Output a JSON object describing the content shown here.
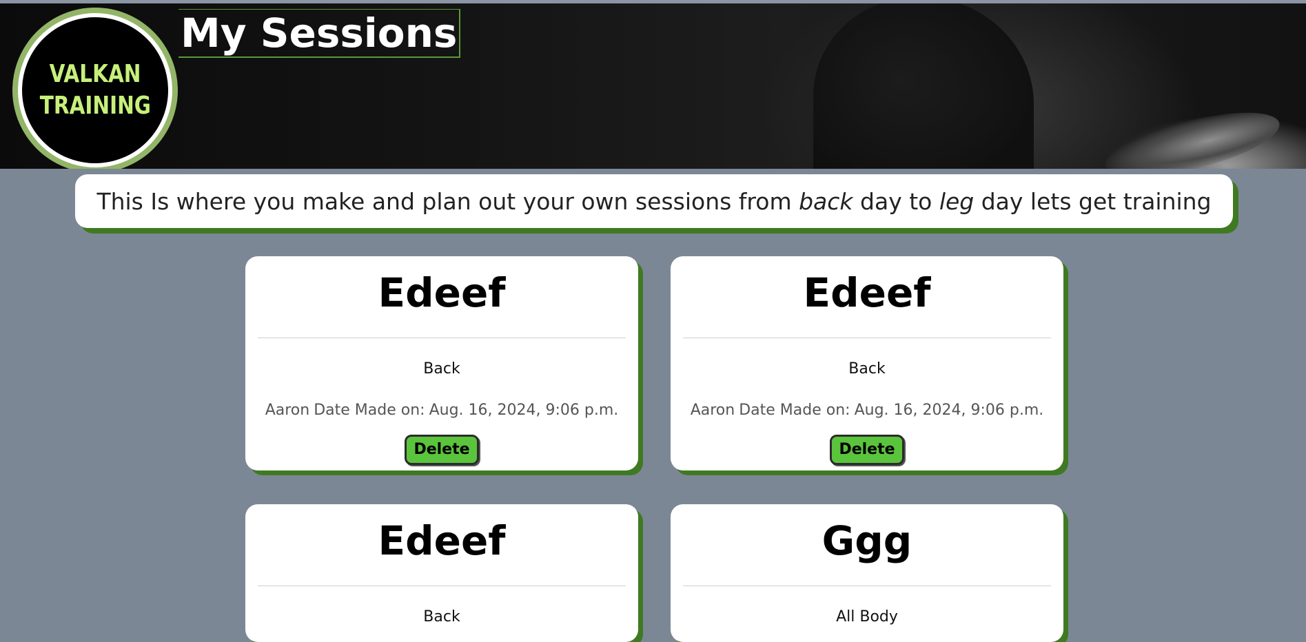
{
  "brand": {
    "logo_line1": "VALKAN",
    "logo_line2": "TRAINING"
  },
  "header": {
    "title": "My Sessions"
  },
  "intro": {
    "before": "This Is where you make and plan out your own sessions from ",
    "em1": "back",
    "middle": " day to ",
    "em2": "leg",
    "after": " day lets get training"
  },
  "sessions": [
    {
      "title": "Edeef",
      "type": "Back",
      "author": "Aaron",
      "date_label": "Date Made on:",
      "date": "Aug. 16, 2024, 9:06 p.m.",
      "delete_label": "Delete"
    },
    {
      "title": "Edeef",
      "type": "Back",
      "author": "Aaron",
      "date_label": "Date Made on:",
      "date": "Aug. 16, 2024, 9:06 p.m.",
      "delete_label": "Delete"
    },
    {
      "title": "Edeef",
      "type": "Back",
      "author": "",
      "date_label": "",
      "date": "",
      "delete_label": ""
    },
    {
      "title": "Ggg",
      "type": "All Body",
      "author": "",
      "date_label": "",
      "date": "",
      "delete_label": ""
    }
  ],
  "colors": {
    "page_bg": "#7c8796",
    "card_shadow": "#3f7a22",
    "button_green": "#5bc43d",
    "logo_text": "#c7f07a",
    "logo_ring_outer": "#93b567"
  }
}
